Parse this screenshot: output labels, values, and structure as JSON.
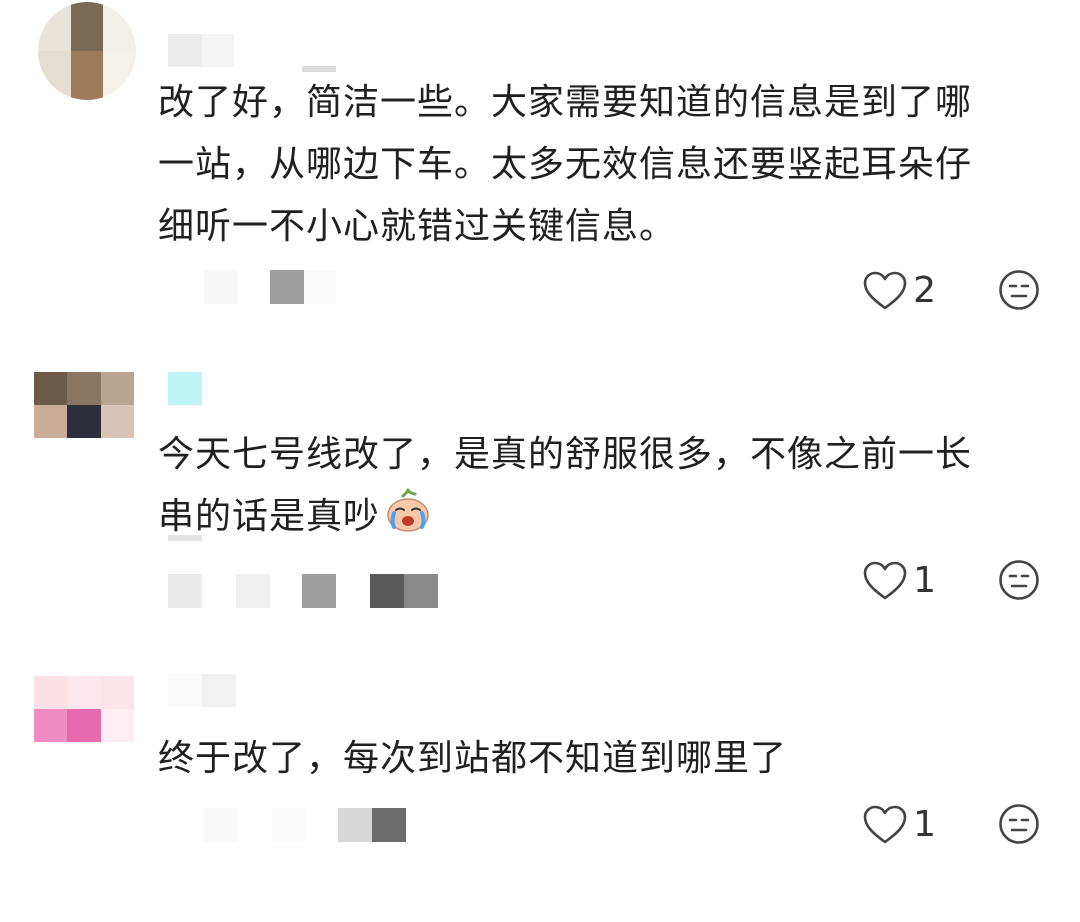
{
  "comments": [
    {
      "text_lines": [
        "改了好，简洁一些。大家需要知道的信息是到了哪",
        "一站，从哪边下车。太多无效信息还要竖起耳朵仔",
        "细听一不小心就错过关键信息。"
      ],
      "likes": "2",
      "has_emoji": false
    },
    {
      "text_lines": [
        "今天七号线改了，是真的舒服很多，不像之前一长",
        "串的话是真吵"
      ],
      "likes": "1",
      "has_emoji": true,
      "emoji_icon": "crying-face-emoji-icon"
    },
    {
      "text_lines": [
        "终于改了，每次到站都不知道到哪里了"
      ],
      "likes": "1",
      "has_emoji": false
    }
  ],
  "icons": {
    "like": "heart-outline-icon",
    "reaction": "neutral-face-icon"
  },
  "colors": {
    "text": "#202020",
    "icon_stroke": "#444444",
    "background": "#ffffff"
  }
}
